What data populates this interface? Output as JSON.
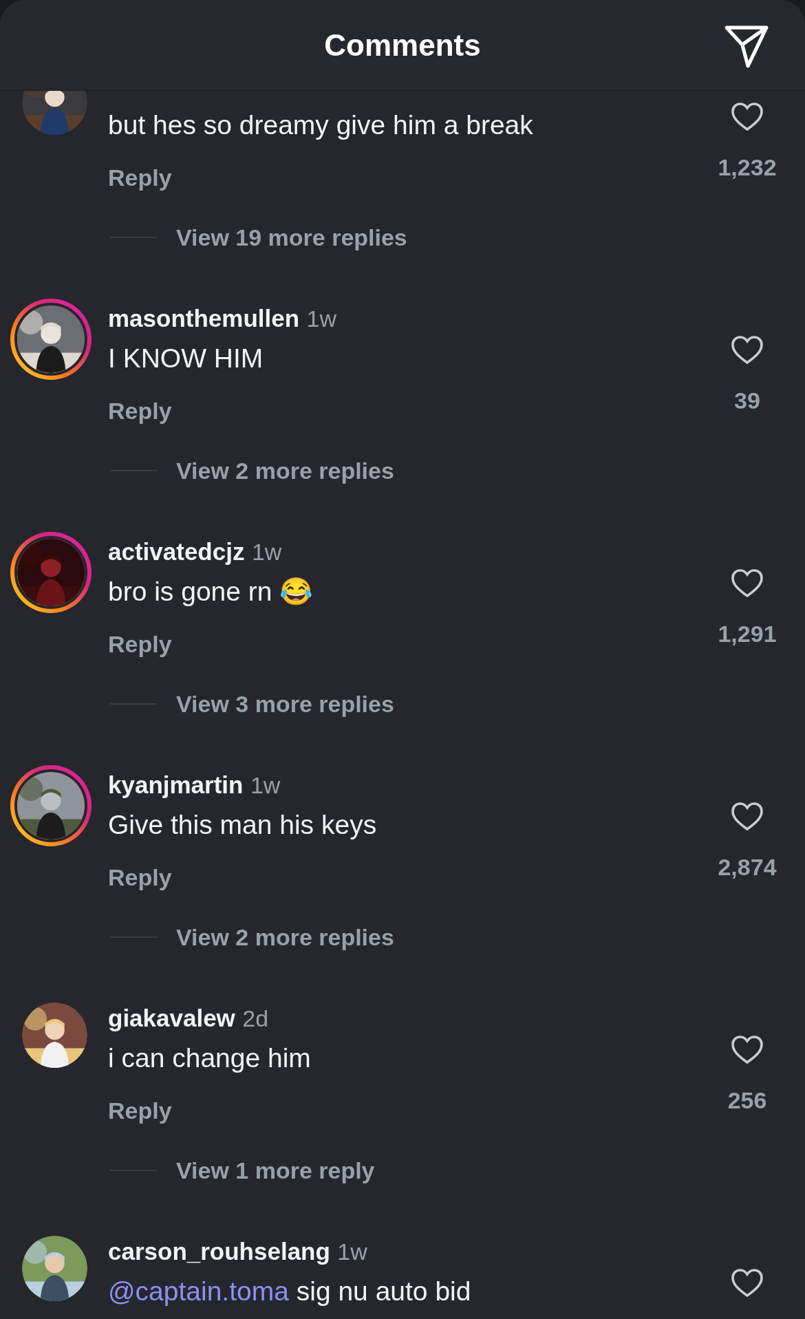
{
  "header": {
    "title": "Comments"
  },
  "comments": [
    {
      "story_ring": false,
      "text": "but hes so dreamy give him a break",
      "reply": "Reply",
      "likes": "1,232",
      "more_replies": "View 19 more replies"
    },
    {
      "story_ring": true,
      "username": "masonthemullen",
      "time": "1w",
      "text": "I KNOW HIM",
      "reply": "Reply",
      "likes": "39",
      "more_replies": "View 2 more replies"
    },
    {
      "story_ring": true,
      "username": "activatedcjz",
      "time": "1w",
      "text": "bro is gone rn 😂",
      "reply": "Reply",
      "likes": "1,291",
      "more_replies": "View 3 more replies"
    },
    {
      "story_ring": true,
      "username": "kyanjmartin",
      "time": "1w",
      "text": "Give this man his keys",
      "reply": "Reply",
      "likes": "2,874",
      "more_replies": "View 2 more replies"
    },
    {
      "story_ring": false,
      "username": "giakavalew",
      "time": "2d",
      "text": "i can change him",
      "reply": "Reply",
      "likes": "256",
      "more_replies": "View 1 more reply"
    },
    {
      "story_ring": false,
      "username": "carson_rouhselang",
      "time": "1w",
      "mention": "@captain.toma",
      "text": "sig nu auto bid"
    }
  ]
}
